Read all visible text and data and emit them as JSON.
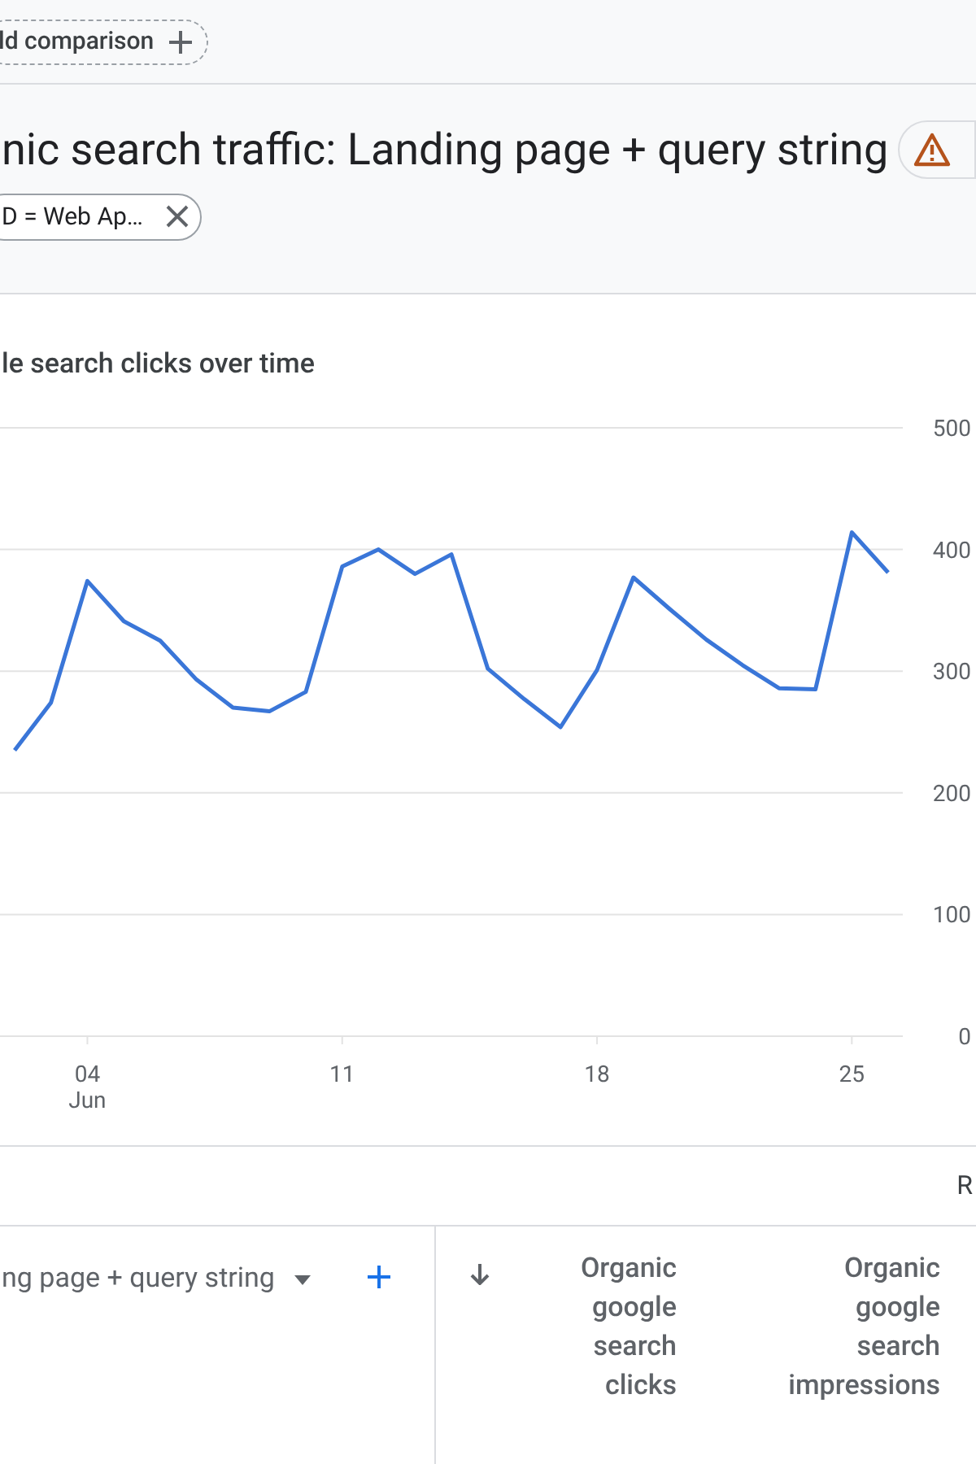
{
  "comparison_button": {
    "label": "ld comparison"
  },
  "report": {
    "title": "nic search traffic: Landing page + query string",
    "warning": true,
    "filter_chip": {
      "label": "D = Web Ap…"
    }
  },
  "chart_card": {
    "title": "le search clicks over time",
    "x_month_label": "Jun",
    "chart_data": {
      "type": "line",
      "x": [
        2,
        3,
        4,
        5,
        6,
        7,
        8,
        9,
        10,
        11,
        12,
        13,
        14,
        15,
        16,
        17,
        18,
        19,
        20,
        21,
        22,
        23,
        24,
        25,
        26
      ],
      "xlim": [
        1.6,
        26.4
      ],
      "grid": true,
      "series": [
        {
          "color": "#3a76d8",
          "values": [
            235,
            274,
            374,
            341,
            325,
            293,
            270,
            267,
            283,
            386,
            400,
            380,
            396,
            302,
            277,
            254,
            301,
            377,
            351,
            326,
            305,
            286,
            285,
            414,
            381
          ]
        }
      ],
      "ylim": [
        0,
        500
      ],
      "yticks": [
        0,
        100,
        200,
        300,
        400,
        500
      ],
      "xticks": [
        {
          "value": 4,
          "label": "04"
        },
        {
          "value": 11,
          "label": "11"
        },
        {
          "value": 18,
          "label": "18"
        },
        {
          "value": 25,
          "label": "25"
        }
      ]
    }
  },
  "table_toolbar": {
    "column_1": "R"
  },
  "table": {
    "dimension_column": "ng page + query string",
    "sort_descending": true,
    "columns": [
      {
        "label": "Organic google search clicks"
      },
      {
        "label": "Organic google search impressions"
      }
    ]
  }
}
